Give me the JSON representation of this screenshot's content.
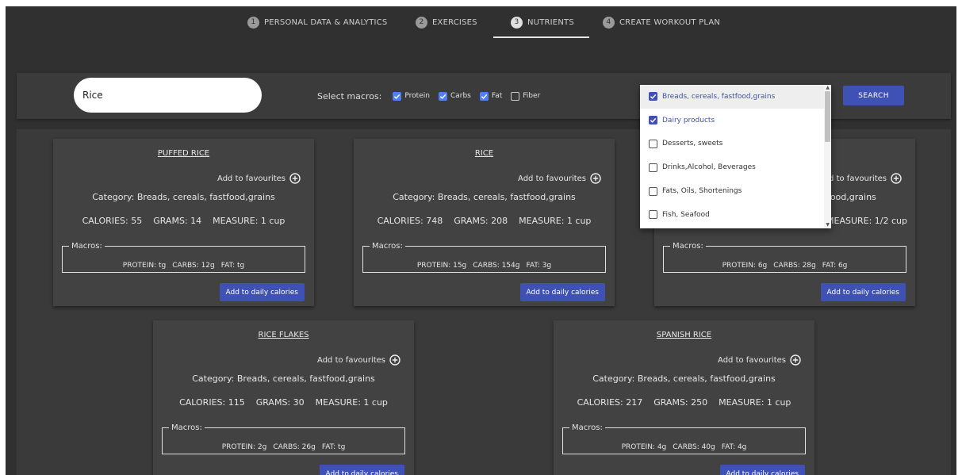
{
  "steps": [
    {
      "num": "1",
      "label": "PERSONAL DATA & ANALYTICS"
    },
    {
      "num": "2",
      "label": "EXERCISES"
    },
    {
      "num": "3",
      "label": "NUTRIENTS"
    },
    {
      "num": "4",
      "label": "CREATE WORKOUT PLAN"
    }
  ],
  "search": {
    "value": "Rice",
    "macros_label": "Select macros:",
    "macros": [
      {
        "label": "Protein",
        "checked": true
      },
      {
        "label": "Carbs",
        "checked": true
      },
      {
        "label": "Fat",
        "checked": true
      },
      {
        "label": "Fiber",
        "checked": false
      }
    ],
    "button": "SEARCH"
  },
  "dropdown": {
    "items": [
      {
        "label": "Breads, cereals, fastfood,grains",
        "checked": true
      },
      {
        "label": "Dairy products",
        "checked": true
      },
      {
        "label": "Desserts, sweets",
        "checked": false
      },
      {
        "label": "Drinks,Alcohol, Beverages",
        "checked": false
      },
      {
        "label": "Fats, Oils, Shortenings",
        "checked": false
      },
      {
        "label": "Fish, Seafood",
        "checked": false
      }
    ]
  },
  "card_common": {
    "fav_label": "Add to favourites",
    "macros_legend": "Macros:",
    "add_label": "Add to daily calories"
  },
  "cards": [
    {
      "title": "PUFFED RICE",
      "category": "Category: Breads, cereals, fastfood,grains",
      "calories": "CALORIES: 55",
      "grams": "GRAMS: 14",
      "measure": "MEASURE: 1 cup",
      "protein": "PROTEIN: tg",
      "carbs": "CARBS: 12g",
      "fat": "FAT: tg"
    },
    {
      "title": "RICE",
      "category": "Category: Breads, cereals, fastfood,grains",
      "calories": "CALORIES: 748",
      "grams": "GRAMS: 208",
      "measure": "MEASURE: 1 cup",
      "protein": "PROTEIN: 15g",
      "carbs": "CARBS: 154g",
      "fat": "FAT: 3g"
    },
    {
      "title": "",
      "category": "Category: Breads, cereals, fastfood,grains",
      "calories": "",
      "grams": "",
      "measure": "MEASURE: 1/2 cup",
      "protein": "PROTEIN: 6g",
      "carbs": "CARBS: 28g",
      "fat": "FAT: 6g"
    },
    {
      "title": "RICE FLAKES",
      "category": "Category: Breads, cereals, fastfood,grains",
      "calories": "CALORIES: 115",
      "grams": "GRAMS: 30",
      "measure": "MEASURE: 1 cup",
      "protein": "PROTEIN: 2g",
      "carbs": "CARBS: 26g",
      "fat": "FAT: tg"
    },
    {
      "title": "SPANISH RICE",
      "category": "Category: Breads, cereals, fastfood,grains",
      "calories": "CALORIES: 217",
      "grams": "GRAMS: 250",
      "measure": "MEASURE: 1 cup",
      "protein": "PROTEIN: 4g",
      "carbs": "CARBS: 40g",
      "fat": "FAT: 4g"
    }
  ],
  "colors": {
    "accent": "#3f51b5",
    "checkbox": "#4f7ff0",
    "background": "#303030",
    "card": "#424242"
  }
}
